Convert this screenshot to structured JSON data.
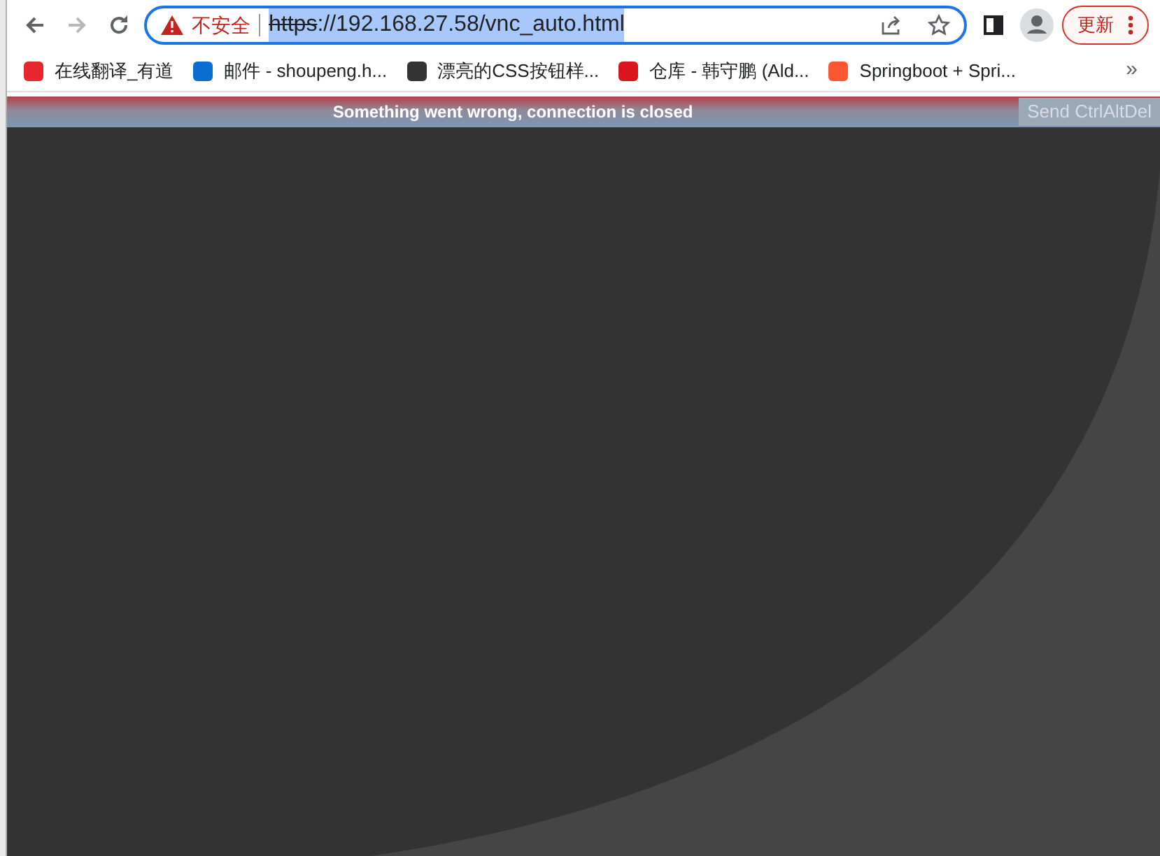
{
  "toolbar": {
    "security_label": "不安全",
    "url_scheme": "https",
    "url_rest": "://192.168.27.58/vnc_auto.html",
    "url_selected": true,
    "update_button": "更新"
  },
  "bookmarks": [
    {
      "label": "在线翻译_有道",
      "color": "#e8262d"
    },
    {
      "label": "邮件 - shoupeng.h...",
      "color": "#0a6ed1"
    },
    {
      "label": "漂亮的CSS按钮样...",
      "color": "#333333"
    },
    {
      "label": "仓库 - 韩守鹏 (Ald...",
      "color": "#d9161e"
    },
    {
      "label": "Springboot + Spri...",
      "color": "#fc5531"
    }
  ],
  "bookmarks_overflow": "»",
  "vnc": {
    "status": "Something went wrong, connection is closed",
    "send_button": "Send CtrlAltDel",
    "send_disabled": true
  }
}
